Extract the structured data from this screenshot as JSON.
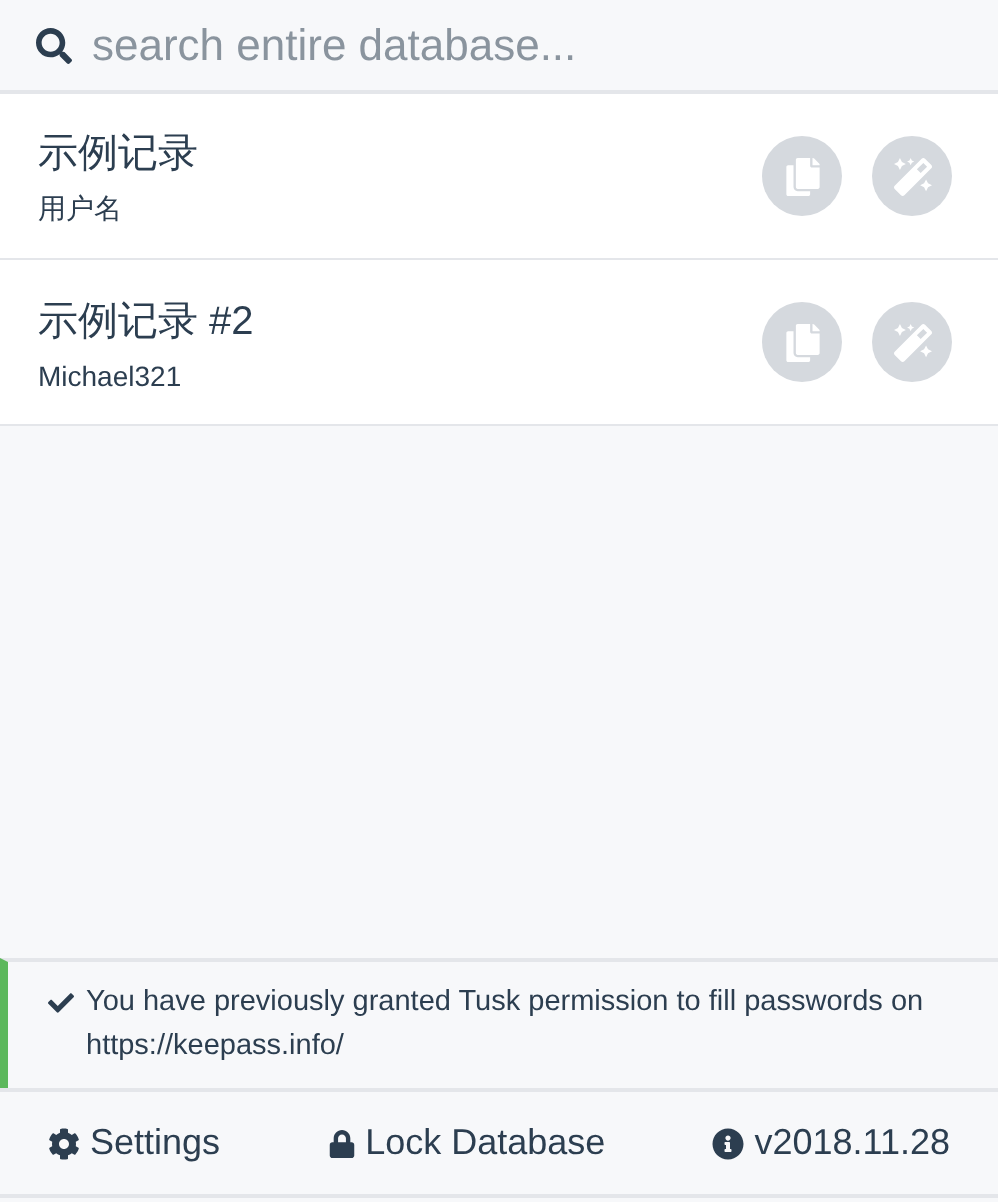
{
  "search": {
    "placeholder": "search entire database..."
  },
  "entries": [
    {
      "title": "示例记录",
      "username": "用户名"
    },
    {
      "title": "示例记录 #2",
      "username": "Michael321"
    }
  ],
  "notice": {
    "text": "You have previously granted Tusk permission to fill passwords on https://keepass.info/"
  },
  "footer": {
    "settings": "Settings",
    "lock": "Lock Database",
    "version": "v2018.11.28"
  }
}
